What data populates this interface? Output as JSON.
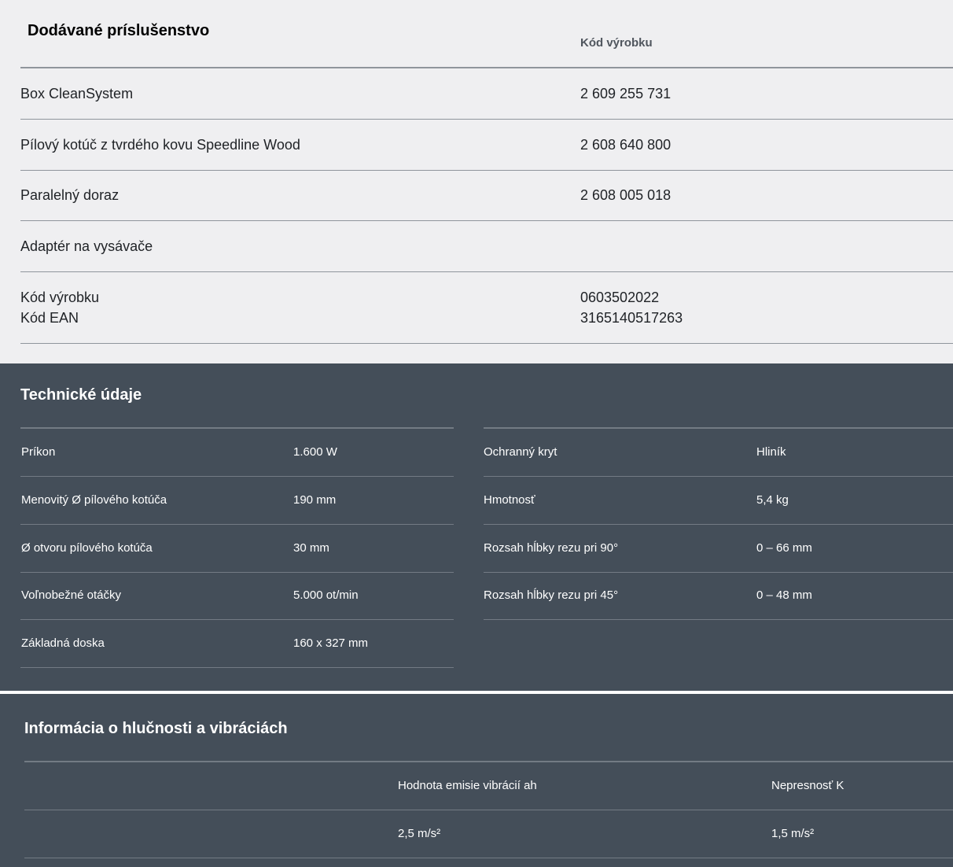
{
  "accessories": {
    "title": "Dodávané príslušenstvo",
    "code_header": "Kód výrobku",
    "items": [
      {
        "name": "Box CleanSystem",
        "code": "2 609 255 731"
      },
      {
        "name": "Pílový kotúč z tvrdého kovu Speedline Wood",
        "code": "2 608 640 800"
      },
      {
        "name": "Paralelný doraz",
        "code": "2 608 005 018"
      },
      {
        "name": "Adaptér na vysávače",
        "code": ""
      }
    ],
    "ids": {
      "product_code_label": "Kód výrobku",
      "ean_label": "Kód EAN",
      "product_code": "0603502022",
      "ean": "3165140517263"
    }
  },
  "tech": {
    "title": "Technické údaje",
    "left": [
      {
        "label": "Príkon",
        "value": "1.600 W"
      },
      {
        "label": "Menovitý Ø pílového kotúča",
        "value": "190 mm"
      },
      {
        "label": "Ø otvoru pílového kotúča",
        "value": "30 mm"
      },
      {
        "label": "Voľnobežné otáčky",
        "value": "5.000 ot/min"
      },
      {
        "label": "Základná doska",
        "value": "160 x 327 mm"
      }
    ],
    "right": [
      {
        "label": "Ochranný kryt",
        "value": "Hliník"
      },
      {
        "label": "Hmotnosť",
        "value": "5,4 kg"
      },
      {
        "label": "Rozsah hĺbky rezu pri 90°",
        "value": "0 – 66 mm"
      },
      {
        "label": "Rozsah hĺbky rezu pri 45°",
        "value": "0 – 48 mm"
      }
    ]
  },
  "noise": {
    "title": "Informácia o hlučnosti a vibráciách",
    "headers": {
      "emission": "Hodnota emisie vibrácií ah",
      "uncertainty": "Nepresnosť K"
    },
    "row": {
      "emission": "2,5 m/s²",
      "uncertainty": "1,5 m/s²"
    }
  }
}
